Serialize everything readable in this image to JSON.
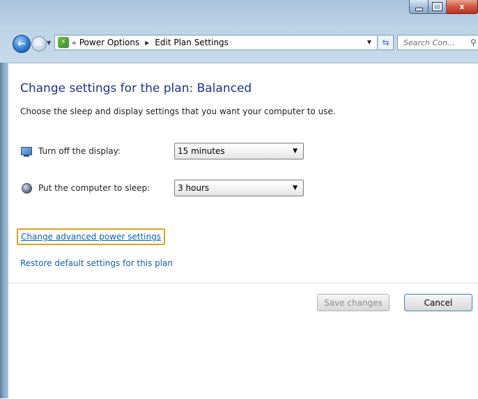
{
  "window": {
    "caption_buttons": {
      "minimize_icon": "minimize-icon",
      "maximize_icon": "maximize-icon",
      "close_label": "x"
    },
    "frame_color": "#bdd3e6"
  },
  "navigation": {
    "back_icon": "back-arrow-icon",
    "forward_icon": "forward-arrow-icon",
    "address_icon": "power-options-icon",
    "overflow_label": "«",
    "breadcrumbs": [
      "Power Options",
      "Edit Plan Settings"
    ],
    "refresh_icon": "refresh-icon",
    "search_placeholder": "Search Con...",
    "search_icon": "search-icon"
  },
  "content": {
    "title": "Change settings for the plan: Balanced",
    "subtitle": "Choose the sleep and display settings that you want your computer to use.",
    "settings": [
      {
        "label": "Turn off the display:",
        "value": "15 minutes",
        "icon": "monitor-icon"
      },
      {
        "label": "Put the computer to sleep:",
        "value": "3 hours",
        "icon": "sleep-moon-icon"
      }
    ],
    "links": {
      "advanced": "Change advanced power settings",
      "restore": "Restore default settings for this plan"
    },
    "buttons": {
      "save": "Save changes",
      "cancel": "Cancel"
    },
    "colors": {
      "title": "#1e3287",
      "link": "#0b5fb3",
      "highlight": "#e0a21c"
    }
  }
}
